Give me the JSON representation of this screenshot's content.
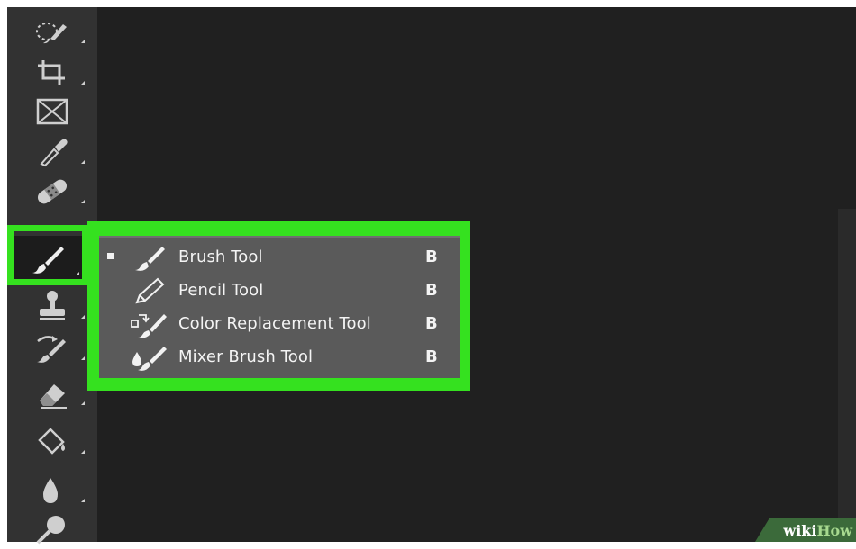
{
  "toolbar": {
    "tools": [
      {
        "name": "quick-selection-tool",
        "icon": "quick-selection-icon"
      },
      {
        "name": "crop-tool",
        "icon": "crop-icon"
      },
      {
        "name": "frame-tool",
        "icon": "frame-icon"
      },
      {
        "name": "eyedropper-tool",
        "icon": "eyedropper-icon"
      },
      {
        "name": "spot-healing-brush-tool",
        "icon": "bandage-icon"
      },
      {
        "name": "brush-tool",
        "icon": "brush-icon",
        "active": true
      },
      {
        "name": "clone-stamp-tool",
        "icon": "stamp-icon"
      },
      {
        "name": "history-brush-tool",
        "icon": "history-brush-icon"
      },
      {
        "name": "eraser-tool",
        "icon": "eraser-icon"
      },
      {
        "name": "paint-bucket-tool",
        "icon": "paint-bucket-icon"
      },
      {
        "name": "blur-tool",
        "icon": "drop-icon"
      },
      {
        "name": "dodge-tool",
        "icon": "dodge-icon"
      }
    ]
  },
  "flyout": {
    "items": [
      {
        "label": "Brush Tool",
        "shortcut": "B",
        "icon": "brush-icon",
        "selected": true
      },
      {
        "label": "Pencil Tool",
        "shortcut": "B",
        "icon": "pencil-icon",
        "selected": false
      },
      {
        "label": "Color Replacement Tool",
        "shortcut": "B",
        "icon": "color-replacement-icon",
        "selected": false
      },
      {
        "label": "Mixer Brush Tool",
        "shortcut": "B",
        "icon": "mixer-brush-icon",
        "selected": false
      }
    ]
  },
  "highlight_color": "#35e11f",
  "watermark": {
    "part1": "wiki",
    "part2": "How"
  }
}
